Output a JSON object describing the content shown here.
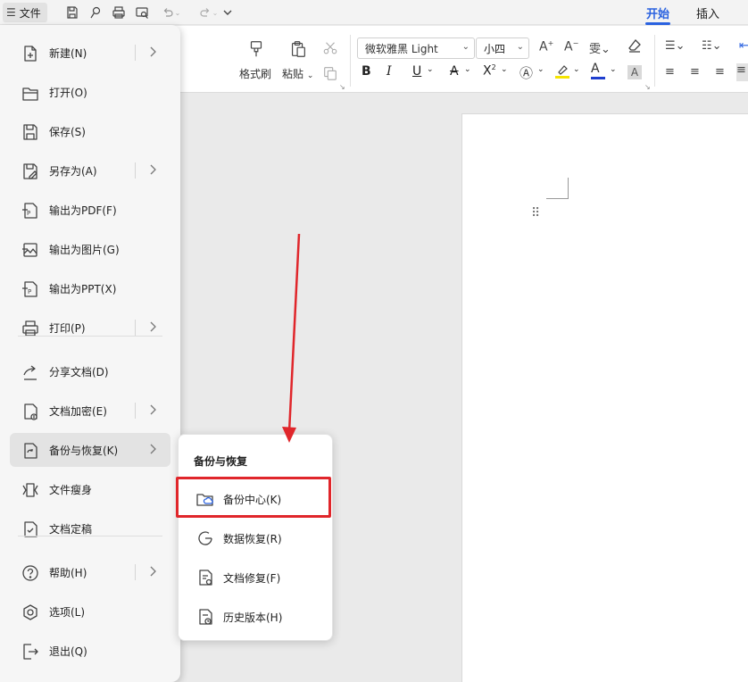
{
  "titlebar": {
    "file_label": "文件",
    "tabs": [
      {
        "label": "开始",
        "active": true
      },
      {
        "label": "插入",
        "active": false
      }
    ]
  },
  "ribbon": {
    "format_painter": "格式刷",
    "paste": "粘贴",
    "font_name": "微软雅黑 Light",
    "font_size": "小四"
  },
  "file_menu": {
    "items": [
      {
        "label": "新建(N)",
        "icon": "new-doc-icon",
        "submenu": true
      },
      {
        "label": "打开(O)",
        "icon": "folder-open-icon",
        "submenu": false
      },
      {
        "label": "保存(S)",
        "icon": "save-icon",
        "submenu": false
      },
      {
        "label": "另存为(A)",
        "icon": "save-as-icon",
        "submenu": true
      },
      {
        "label": "输出为PDF(F)",
        "icon": "export-pdf-icon",
        "submenu": false
      },
      {
        "label": "输出为图片(G)",
        "icon": "export-image-icon",
        "submenu": false
      },
      {
        "label": "输出为PPT(X)",
        "icon": "export-ppt-icon",
        "submenu": false
      },
      {
        "label": "打印(P)",
        "icon": "print-icon",
        "submenu": true
      },
      {
        "label": "分享文档(D)",
        "icon": "share-icon",
        "submenu": false
      },
      {
        "label": "文档加密(E)",
        "icon": "encrypt-icon",
        "submenu": true
      },
      {
        "label": "备份与恢复(K)",
        "icon": "backup-icon",
        "submenu": true,
        "selected": true
      },
      {
        "label": "文件瘦身",
        "icon": "slim-icon",
        "submenu": false
      },
      {
        "label": "文档定稿",
        "icon": "finalize-icon",
        "submenu": false
      },
      {
        "label": "帮助(H)",
        "icon": "help-icon",
        "submenu": true
      },
      {
        "label": "选项(L)",
        "icon": "options-icon",
        "submenu": false
      },
      {
        "label": "退出(Q)",
        "icon": "exit-icon",
        "submenu": false
      }
    ]
  },
  "submenu": {
    "title": "备份与恢复",
    "items": [
      {
        "label": "备份中心(K)",
        "icon": "backup-center-icon",
        "highlighted": true
      },
      {
        "label": "数据恢复(R)",
        "icon": "data-recovery-icon"
      },
      {
        "label": "文档修复(F)",
        "icon": "doc-repair-icon"
      },
      {
        "label": "历史版本(H)",
        "icon": "history-version-icon"
      }
    ]
  },
  "colors": {
    "accent": "#2a62e0",
    "highlight_annotation": "#e0262b",
    "highlight_yellow": "#f5e400",
    "font_color_blue": "#1f3fcf"
  }
}
